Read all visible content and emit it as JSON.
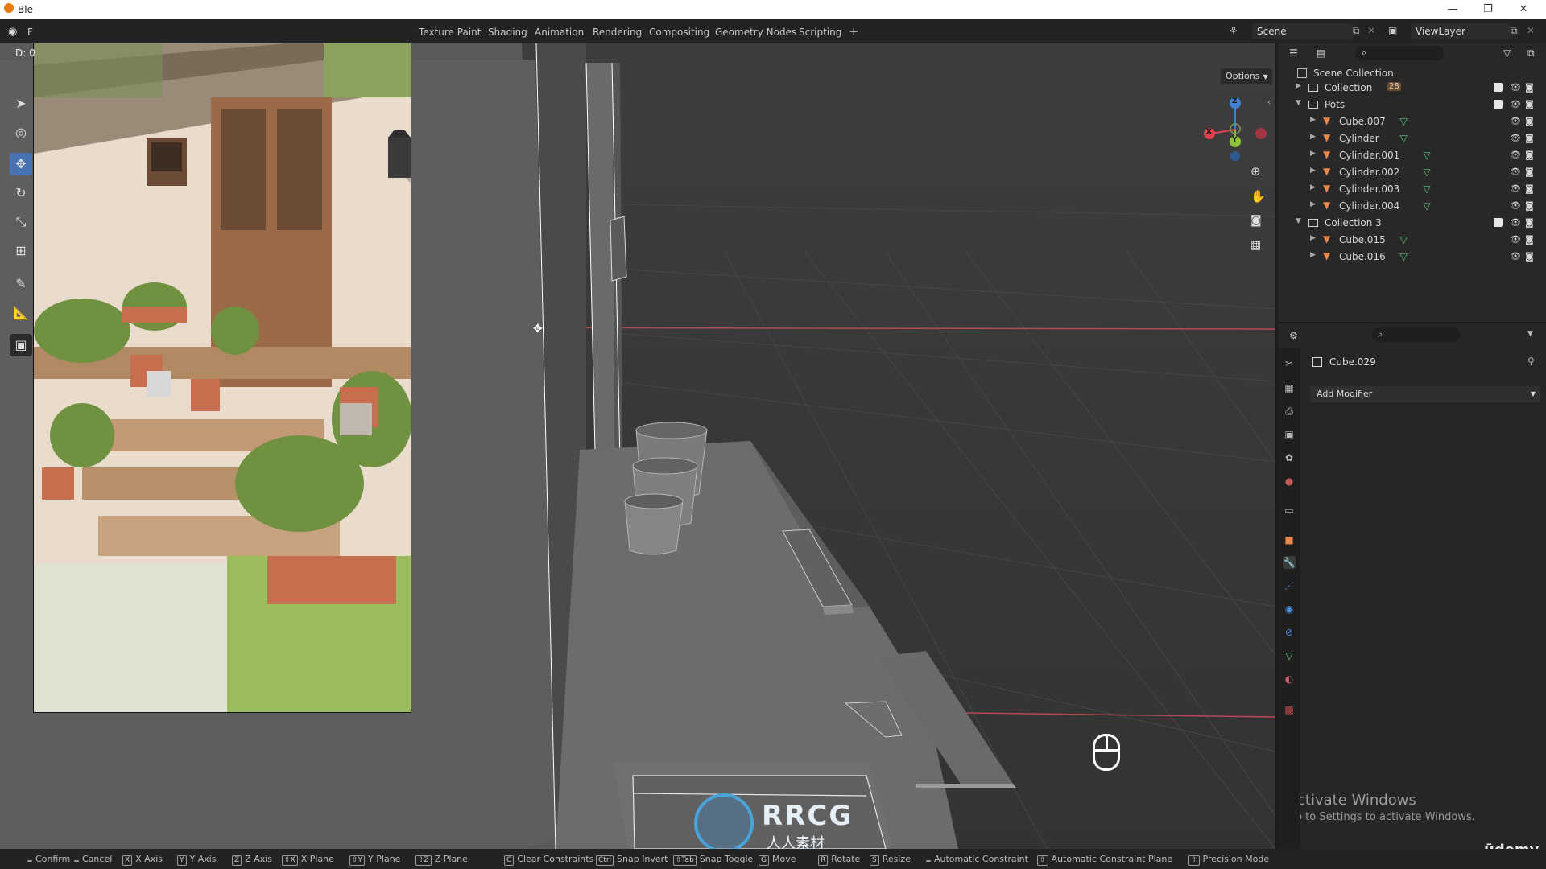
{
  "window": {
    "title": "Ble",
    "controls": [
      "—",
      "❐",
      "✕"
    ]
  },
  "header_overlay": {
    "menu_fragment": "F",
    "delta_readout": "D: 0"
  },
  "workspace_tabs": [
    "Texture Paint",
    "Shading",
    "Animation",
    "Rendering",
    "Compositing",
    "Geometry Nodes",
    "Scripting",
    "+"
  ],
  "scene": {
    "name": "Scene",
    "view_layer": "ViewLayer"
  },
  "viewport": {
    "options_label": "Options",
    "gizmo_axes": {
      "x": "X",
      "y": "Y",
      "z": "Z"
    },
    "watermark_text": "RRCG",
    "watermark_sub": "人人素材",
    "activate_title": "Activate Windows",
    "activate_sub": "Go to Settings to activate Windows.",
    "udemy": "ūdemy"
  },
  "toolbar": {
    "tools": [
      "select-box",
      "cursor",
      "move",
      "rotate",
      "scale",
      "transform",
      "annotate",
      "measure",
      "add-cube"
    ],
    "active": "move"
  },
  "outliner": {
    "root": "Scene Collection",
    "rows": [
      {
        "label": "Collection",
        "badge": "28",
        "level": 1,
        "type": "collection",
        "expanded": false
      },
      {
        "label": "Pots",
        "level": 1,
        "type": "collection",
        "expanded": true
      },
      {
        "label": "Cube.007",
        "level": 2,
        "type": "object"
      },
      {
        "label": "Cylinder",
        "level": 2,
        "type": "object"
      },
      {
        "label": "Cylinder.001",
        "level": 2,
        "type": "object"
      },
      {
        "label": "Cylinder.002",
        "level": 2,
        "type": "object"
      },
      {
        "label": "Cylinder.003",
        "level": 2,
        "type": "object"
      },
      {
        "label": "Cylinder.004",
        "level": 2,
        "type": "object"
      },
      {
        "label": "Collection 3",
        "level": 1,
        "type": "collection",
        "expanded": true
      },
      {
        "label": "Cube.015",
        "level": 2,
        "type": "object"
      },
      {
        "label": "Cube.016",
        "level": 2,
        "type": "object"
      }
    ]
  },
  "properties": {
    "object_name": "Cube.029",
    "add_modifier_label": "Add Modifier"
  },
  "statusbar": {
    "items": [
      "Confirm",
      "Cancel",
      "X Axis",
      "Y Axis",
      "Z Axis",
      "X Plane",
      "Y Plane",
      "Z Plane",
      "Clear Constraints",
      "Snap Invert",
      "Snap Toggle",
      "Move",
      "Rotate",
      "Resize",
      "Automatic Constraint",
      "Automatic Constraint Plane",
      "Precision Mode"
    ],
    "keys": [
      "",
      "",
      "X",
      "Y",
      "Z",
      "⇧X",
      "⇧Y",
      "⇧Z",
      "C",
      "Ctrl",
      "⇧Tab",
      "G",
      "R",
      "S",
      "",
      "⇧",
      "⇧"
    ]
  },
  "colors": {
    "accent": "#4772b3",
    "mesh_icon": "#5fc67f",
    "object_icon": "#e8884a",
    "axis_x": "#e04050",
    "axis_y": "#8cc43c",
    "axis_z": "#3f80d6"
  }
}
